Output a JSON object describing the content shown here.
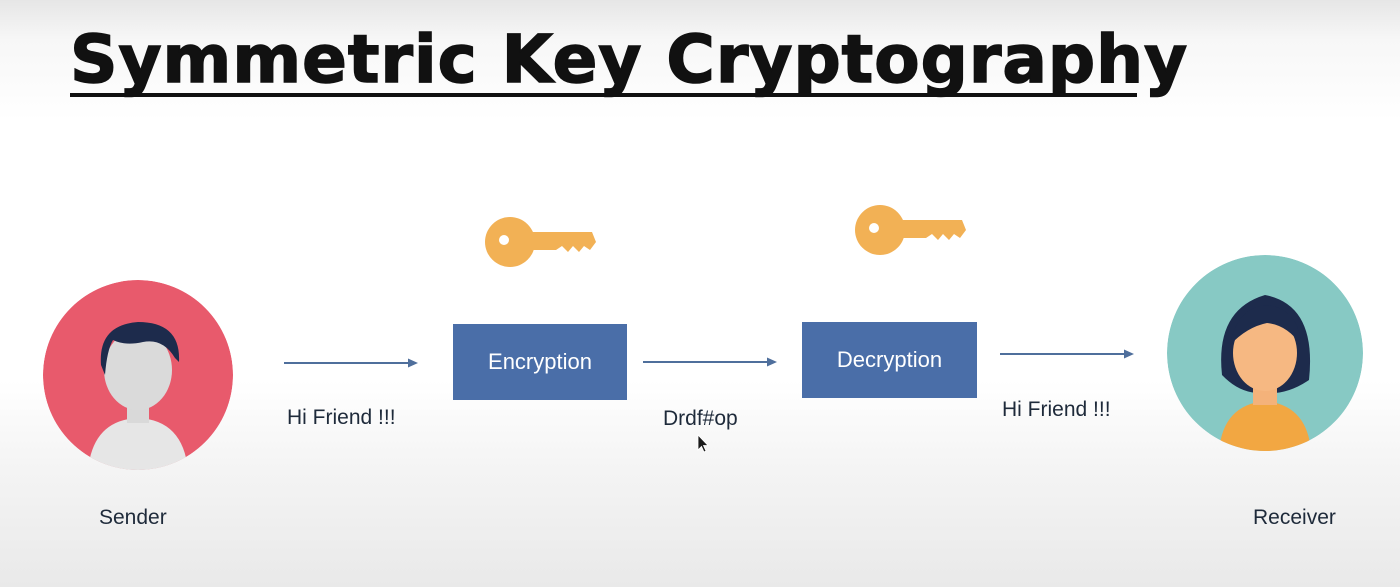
{
  "slide": {
    "title": "Symmetric Key Cryptography"
  },
  "sender": {
    "label": "Sender"
  },
  "receiver": {
    "label": "Receiver"
  },
  "steps": {
    "encryption": "Encryption",
    "decryption": "Decryption"
  },
  "messages": {
    "plaintext_in": "Hi Friend !!!",
    "ciphertext": "Drdf#op",
    "plaintext_out": "Hi Friend !!!"
  },
  "colors": {
    "sender_circle": "#e85a6c",
    "receiver_circle": "#87c9c4",
    "box": "#4a6ea8",
    "key": "#f2b155",
    "arrow": "#4f6f9c"
  },
  "icons": [
    "key-icon",
    "person-avatar",
    "arrow-right",
    "mouse-cursor"
  ]
}
